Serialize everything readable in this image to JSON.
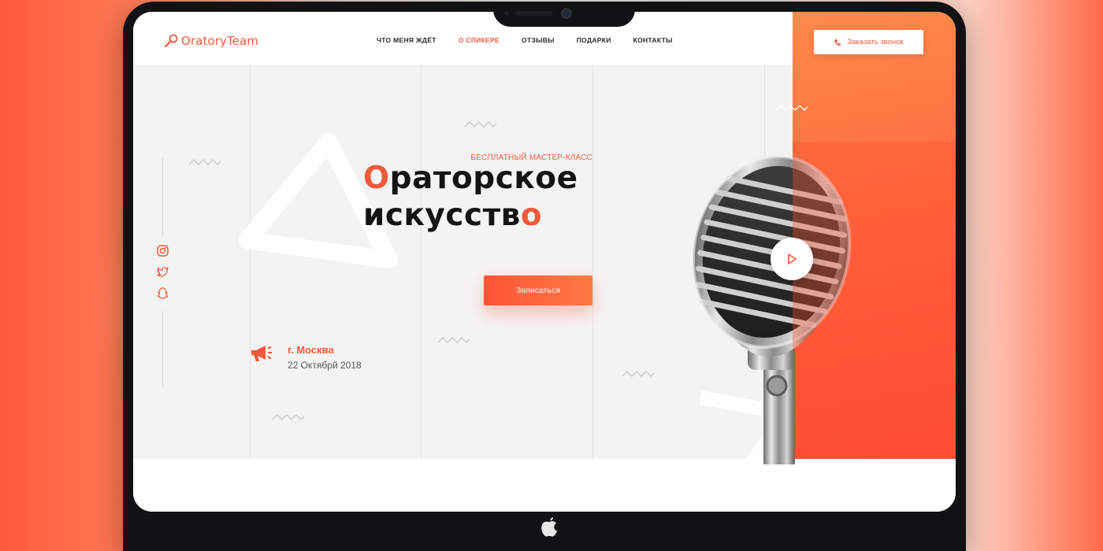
{
  "header": {
    "logo_text": "OratoryTeam",
    "nav": [
      {
        "label": "ЧТО МЕНЯ ЖДЁТ",
        "active": false
      },
      {
        "label": "О СПИКЕРЕ",
        "active": true
      },
      {
        "label": "ОТЗЫВЫ",
        "active": false
      },
      {
        "label": "ПОДАРКИ",
        "active": false
      },
      {
        "label": "КОНТАКТЫ",
        "active": false
      }
    ],
    "call_button": "Заказать звонок"
  },
  "hero": {
    "subtitle": "БЕСПЛАТНЫЙ МАСТЕР-КЛАСС",
    "title_line1": "Ораторское",
    "title_line2": "искусствО",
    "signup_button": "Записаться"
  },
  "event": {
    "city": "г. Москва",
    "date": "22 Октябрй 2018"
  },
  "social": [
    "instagram-icon",
    "twitter-icon",
    "snapchat-icon"
  ],
  "colors": {
    "accent": "#f25a3c",
    "accent_gradient_start": "#ff5336",
    "accent_gradient_end": "#ff7a45",
    "hero_background": "#f4f3f3"
  }
}
